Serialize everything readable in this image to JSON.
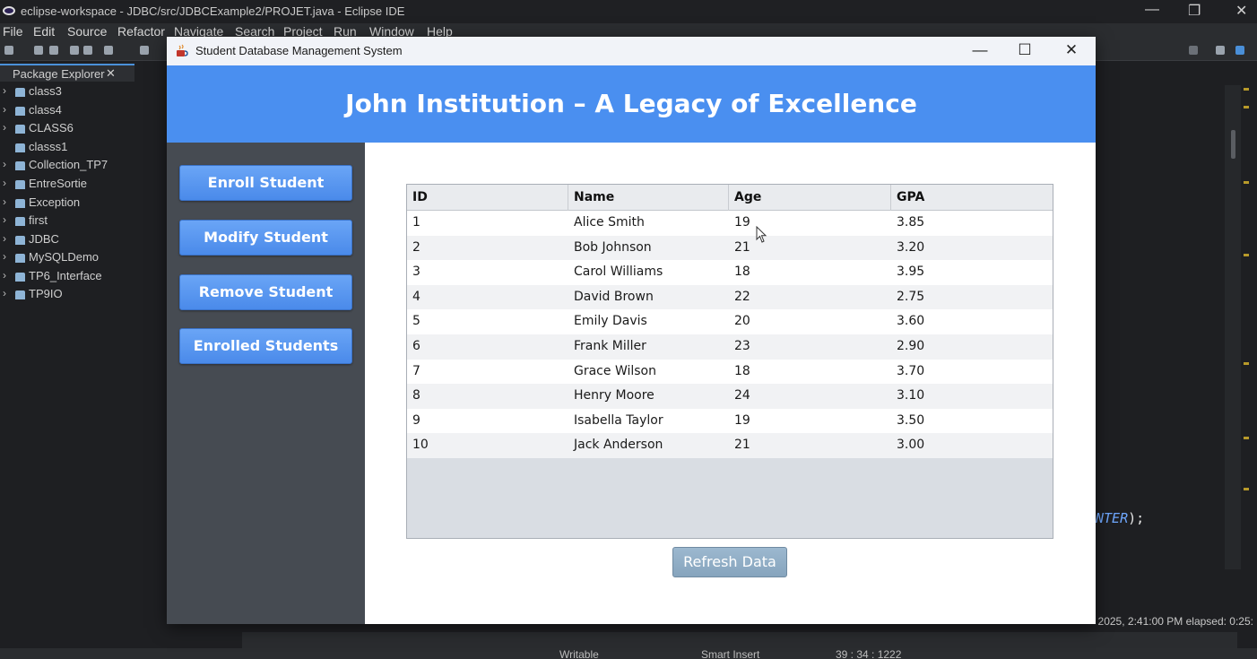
{
  "ide": {
    "window_title": "eclipse-workspace - JDBC/src/JDBCExample2/PROJET.java - Eclipse IDE",
    "menu": [
      "File",
      "Edit",
      "Source",
      "Refactor",
      "Navigate",
      "Search",
      "Project",
      "Run",
      "Window",
      "Help"
    ],
    "package_explorer": {
      "tab_label": "Package Explorer",
      "close_glyph": "✕",
      "projects": [
        "class3",
        "class4",
        "CLASS6",
        "classs1",
        "Collection_TP7",
        "EntreSortie",
        "Exception",
        "first",
        "JDBC",
        "MySQLDemo",
        "TP6_Interface",
        "TP9IO"
      ]
    },
    "code_fragment": {
      "keyword": "NTER",
      "rest": ");"
    },
    "console_text": "2025, 2:41:00 PM elapsed: 0:25:",
    "status": {
      "mode": "Writable",
      "insert": "Smart Insert",
      "position": "39 : 34 : 1222"
    }
  },
  "app": {
    "window_title": "Student Database Management System",
    "controls": {
      "minimize": "—",
      "maximize": "☐",
      "close": "✕"
    },
    "header_title": "John Institution – A Legacy of Excellence",
    "sidebar_buttons": [
      "Enroll Student",
      "Modify Student",
      "Remove Student",
      "Enrolled Students"
    ],
    "table": {
      "columns": [
        "ID",
        "Name",
        "Age",
        "GPA"
      ],
      "rows": [
        [
          "1",
          "Alice Smith",
          "19",
          "3.85"
        ],
        [
          "2",
          "Bob Johnson",
          "21",
          "3.20"
        ],
        [
          "3",
          "Carol Williams",
          "18",
          "3.95"
        ],
        [
          "4",
          "David Brown",
          "22",
          "2.75"
        ],
        [
          "5",
          "Emily Davis",
          "20",
          "3.60"
        ],
        [
          "6",
          "Frank Miller",
          "23",
          "2.90"
        ],
        [
          "7",
          "Grace Wilson",
          "18",
          "3.70"
        ],
        [
          "8",
          "Henry Moore",
          "24",
          "3.10"
        ],
        [
          "9",
          "Isabella Taylor",
          "19",
          "3.50"
        ],
        [
          "10",
          "Jack Anderson",
          "21",
          "3.00"
        ]
      ]
    },
    "refresh_label": "Refresh Data",
    "colors": {
      "header_bg": "#4a8ff0",
      "sidebar_bg": "#464b52",
      "button_bg": "#4a8aea",
      "refresh_bg": "#86a4bd"
    }
  }
}
